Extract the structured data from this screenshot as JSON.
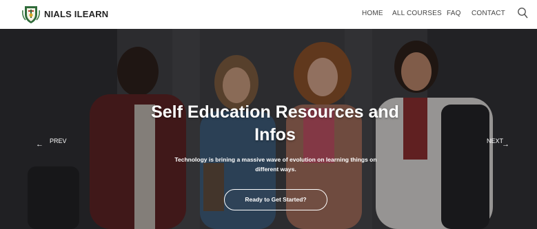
{
  "header": {
    "brand": "NIALS ILEARN",
    "nav": {
      "home": "HOME",
      "courses": "ALL COURSES",
      "faq": "FAQ",
      "contact": "CONTACT"
    }
  },
  "hero": {
    "title": "Self Education Resources and Infos",
    "subtitle": "Technology is brining a massive wave of evolution on learning things on different ways.",
    "cta": "Ready to Get Started?",
    "prev": "PREV",
    "next": "NEXT"
  },
  "icons": {
    "logo": "shield-crest-icon",
    "search": "search-icon",
    "prev": "arrow-left-icon",
    "next": "arrow-right-icon"
  },
  "colors": {
    "header_bg": "#ffffff",
    "nav_text": "#444444",
    "overlay": "#2f2f32",
    "hero_text": "#ffffff"
  }
}
